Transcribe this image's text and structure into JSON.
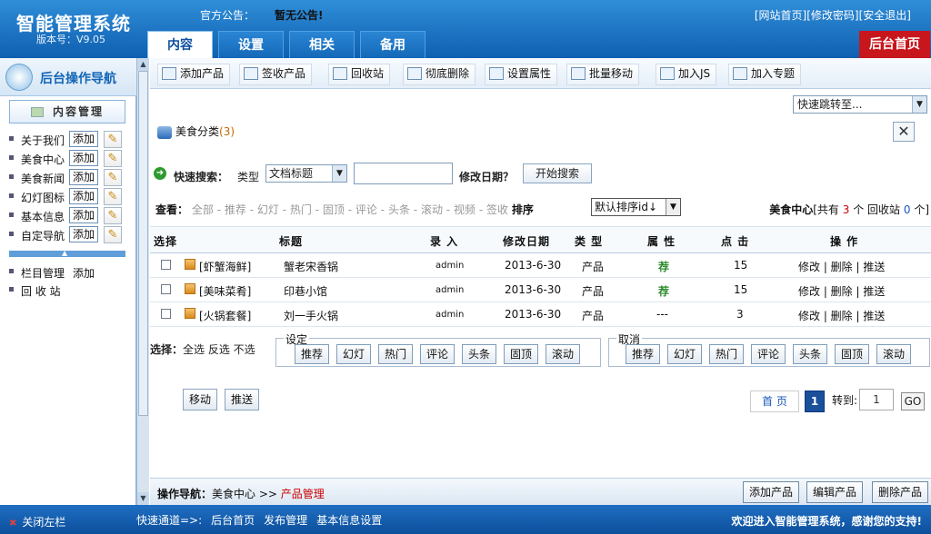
{
  "header": {
    "title": "智能管理系统",
    "version": "版本号：V9.05",
    "notice_label": "官方公告：",
    "notice_text": "暂无公告!",
    "top_links": [
      "[网站首页]",
      "[修改密码]",
      "[安全退出]"
    ],
    "tabs": [
      "内容",
      "设置",
      "相关",
      "备用"
    ],
    "active_tab": 0,
    "home_button": "后台首页"
  },
  "sidebar": {
    "nav_title": "后台操作导航",
    "section_title": "内容管理",
    "items": [
      {
        "label": "关于我们",
        "add": "添加"
      },
      {
        "label": "美食中心",
        "add": "添加"
      },
      {
        "label": "美食新闻",
        "add": "添加"
      },
      {
        "label": "幻灯图标",
        "add": "添加"
      },
      {
        "label": "基本信息",
        "add": "添加"
      },
      {
        "label": "自定导航",
        "add": "添加"
      }
    ],
    "extra": [
      {
        "label": "栏目管理",
        "add": "添加"
      },
      {
        "label": "回 收 站",
        "add": ""
      }
    ]
  },
  "toolbar": {
    "buttons": [
      "添加产品",
      "签收产品",
      "回收站",
      "彻底删除",
      "设置属性",
      "批量移动",
      "加入JS",
      "加入专题"
    ],
    "jump_select": "快速跳转至..."
  },
  "category": {
    "label": "美食分类",
    "count": "(3)"
  },
  "search": {
    "label": "快速搜索：",
    "type_label": "类型",
    "type_value": "文档标题",
    "input_value": "",
    "date_label": "修改日期？",
    "button": "开始搜索"
  },
  "view": {
    "label": "查看：",
    "filters": [
      "全部",
      "推荐",
      "幻灯",
      "热门",
      "固顶",
      "评论",
      "头条",
      "滚动",
      "视频",
      "签收"
    ],
    "sort_label": "排序",
    "sort_value": "默认排序id↓",
    "summary_name": "美食中心",
    "summary_total_prefix": "[共有",
    "summary_total": "3",
    "summary_total_suffix": "个 回收站",
    "summary_recycle": "0",
    "summary_recycle_suffix": "个]"
  },
  "table": {
    "headers": [
      "选择",
      "标题",
      "录 入",
      "修改日期",
      "类 型",
      "属 性",
      "点 击",
      "操 作"
    ],
    "rows": [
      {
        "category": "[虾蟹海鲜]",
        "title": "蟹老宋香锅",
        "author": "admin",
        "date": "2013-6-30",
        "type": "产品",
        "attr": "荐",
        "clicks": "15",
        "ops": "修改 | 删除 | 推送"
      },
      {
        "category": "[美味菜肴]",
        "title": "印巷小馆",
        "author": "admin",
        "date": "2013-6-30",
        "type": "产品",
        "attr": "荐",
        "clicks": "15",
        "ops": "修改 | 删除 | 推送"
      },
      {
        "category": "[火锅套餐]",
        "title": "刘一手火锅",
        "author": "admin",
        "date": "2013-6-30",
        "type": "产品",
        "attr": "---",
        "clicks": "3",
        "ops": "修改 | 删除 | 推送"
      }
    ]
  },
  "batch": {
    "select_label": "选择：",
    "select_options": "全选 反选 不选",
    "set_legend": "设定",
    "cancel_legend": "取消",
    "attrs": [
      "推荐",
      "幻灯",
      "热门",
      "评论",
      "头条",
      "固顶",
      "滚动"
    ],
    "move": "移动",
    "push": "推送"
  },
  "pager": {
    "first": "首 页",
    "current": "1",
    "goto_label": "转到:",
    "goto_value": "1",
    "go": "GO"
  },
  "opnav": {
    "label": "操作导航：",
    "crumb": "美食中心 >> ",
    "current": "产品管理",
    "buttons": [
      "添加产品",
      "编辑产品",
      "删除产品"
    ]
  },
  "footer": {
    "close_left": "关闭左栏",
    "quick_label": "快速通道=>:",
    "quick_links": [
      "后台首页",
      "发布管理",
      "基本信息设置"
    ],
    "welcome": "欢迎进入智能管理系统，感谢您的支持!"
  },
  "colors": {
    "header_blue": "#1468b8",
    "home_red": "#c8161d",
    "accent_red": "#cc0000"
  }
}
